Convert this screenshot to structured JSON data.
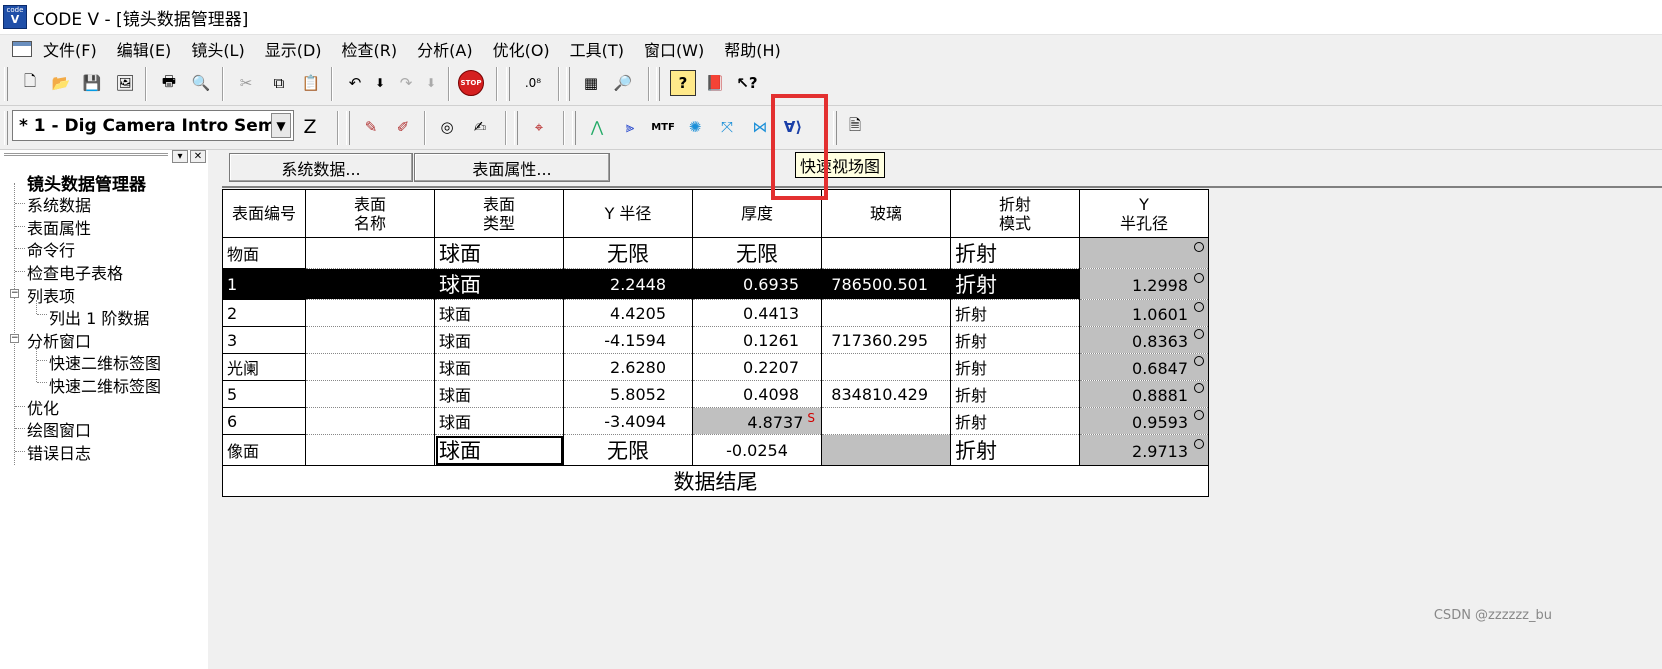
{
  "window": {
    "title": "CODE V - [镜头数据管理器]",
    "app_icon_label": "code V"
  },
  "menu": [
    "文件(F)",
    "编辑(E)",
    "镜头(L)",
    "显示(D)",
    "检查(R)",
    "分析(A)",
    "优化(O)",
    "工具(T)",
    "窗口(W)",
    "帮助(H)"
  ],
  "toolbar": {
    "lens_selector": "* 1 - Dig Camera Intro Sem",
    "z_label": "Z",
    "mtf_label": "MTF",
    "stop_label": "STOP",
    "tooltip": "快速视场图"
  },
  "tree": {
    "root": "镜头数据管理器",
    "items": [
      "系统数据",
      "表面属性",
      "命令行",
      "检查电子表格",
      "列表项",
      "列出 1 阶数据",
      "分析窗口",
      "快速二维标签图",
      "快速二维标签图",
      "优化",
      "绘图窗口",
      "错误日志"
    ]
  },
  "main": {
    "system_data_button": "系统数据...",
    "surface_props_button": "表面属性..."
  },
  "table": {
    "headers": {
      "surface_no": "表面编号",
      "name_l1": "表面",
      "name_l2": "名称",
      "type_l1": "表面",
      "type_l2": "类型",
      "y_radius": "Y 半径",
      "thickness": "厚度",
      "glass": "玻璃",
      "mode_l1": "折射",
      "mode_l2": "模式",
      "aper_l1": "Y",
      "aper_l2": "半孔径"
    },
    "rows": [
      {
        "no": "物面",
        "name": "",
        "type": "球面",
        "radius": "无限",
        "thickness": "无限",
        "glass": "",
        "mode": "折射",
        "aperture": ""
      },
      {
        "no": "1",
        "name": "",
        "type": "球面",
        "radius": "2.2448",
        "thickness": "0.6935",
        "glass": "786500.501",
        "mode": "折射",
        "aperture": "1.2998"
      },
      {
        "no": "2",
        "name": "",
        "type": "球面",
        "radius": "4.4205",
        "thickness": "0.4413",
        "glass": "",
        "mode": "折射",
        "aperture": "1.0601"
      },
      {
        "no": "3",
        "name": "",
        "type": "球面",
        "radius": "-4.1594",
        "thickness": "0.1261",
        "glass": "717360.295",
        "mode": "折射",
        "aperture": "0.8363"
      },
      {
        "no": "光阑",
        "name": "",
        "type": "球面",
        "radius": "2.6280",
        "thickness": "0.2207",
        "glass": "",
        "mode": "折射",
        "aperture": "0.6847"
      },
      {
        "no": "5",
        "name": "",
        "type": "球面",
        "radius": "5.8052",
        "thickness": "0.4098",
        "glass": "834810.429",
        "mode": "折射",
        "aperture": "0.8881"
      },
      {
        "no": "6",
        "name": "",
        "type": "球面",
        "radius": "-3.4094",
        "thickness": "4.8737",
        "thickness_flag": "S",
        "glass": "",
        "mode": "折射",
        "aperture": "0.9593"
      },
      {
        "no": "像面",
        "name": "",
        "type": "球面",
        "radius": "无限",
        "thickness": "-0.0254",
        "glass": "",
        "mode": "折射",
        "aperture": "2.9713"
      }
    ],
    "end_label": "数据结尾"
  },
  "watermark": "CSDN @zzzzzz_bu",
  "colors": {
    "highlight_box": "#e33030",
    "tooltip_bg": "#ffffe1",
    "selected_row": "#000000"
  }
}
